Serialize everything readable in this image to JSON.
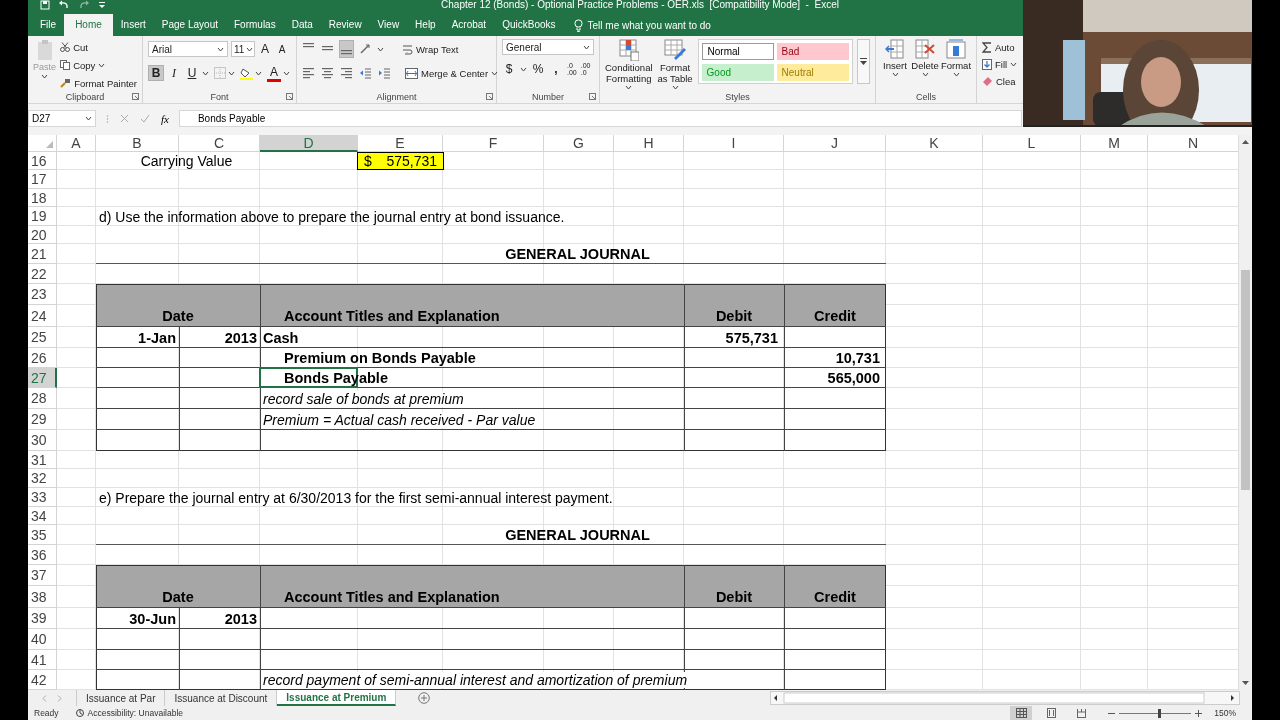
{
  "window": {
    "title": "Chapter 12 (Bonds) - Optional Practice Problems - OER.xls  [Compatibility Mode]  -  Excel"
  },
  "menu_tabs": [
    {
      "label": "File",
      "selected": false
    },
    {
      "label": "Home",
      "selected": true
    },
    {
      "label": "Insert",
      "selected": false
    },
    {
      "label": "Page Layout",
      "selected": false
    },
    {
      "label": "Formulas",
      "selected": false
    },
    {
      "label": "Data",
      "selected": false
    },
    {
      "label": "Review",
      "selected": false
    },
    {
      "label": "View",
      "selected": false
    },
    {
      "label": "Help",
      "selected": false
    },
    {
      "label": "Acrobat",
      "selected": false
    },
    {
      "label": "QuickBooks",
      "selected": false
    }
  ],
  "tell_me": {
    "placeholder": "Tell me what you want to do"
  },
  "ribbon": {
    "clipboard": {
      "name": "Clipboard",
      "paste": {
        "label": "Paste",
        "disabled": true
      },
      "cut": "Cut",
      "copy": "Copy",
      "format_painter": "Format Painter"
    },
    "font": {
      "name": "Font",
      "font_name": "Arial",
      "font_size": "11",
      "grow": "A",
      "shrink": "A",
      "font_color": "A",
      "buttons": [
        {
          "label": "B",
          "kind": "bold",
          "on": true
        },
        {
          "label": "I",
          "kind": "italic",
          "on": false
        },
        {
          "label": "U",
          "kind": "underline",
          "on": false
        }
      ]
    },
    "alignment": {
      "name": "Alignment",
      "wrap_text": "Wrap Text",
      "merge_center": "Merge & Center",
      "vertical_align": [
        {
          "selected": false
        },
        {
          "selected": false
        },
        {
          "selected": true
        }
      ]
    },
    "number": {
      "name": "Number",
      "format": "General",
      "currency": "$",
      "percent": "%",
      "comma": ",",
      "increase_decimal": [
        ".0",
        ".00"
      ],
      "decrease_decimal": [
        ".00",
        ".0"
      ]
    },
    "styles": {
      "name": "Styles",
      "conditional": "Conditional Formatting",
      "format_table": "Format as Table",
      "cell_styles": [
        {
          "label": "Normal",
          "color": "#ffffff"
        },
        {
          "label": "Bad",
          "color": "#ffc7ce"
        },
        {
          "label": "Good",
          "color": "#c6efce"
        },
        {
          "label": "Neutral",
          "color": "#ffeb9c"
        }
      ]
    },
    "cells": {
      "name": "Cells",
      "buttons": [
        "Insert",
        "Delete",
        "Format"
      ]
    },
    "editing": {
      "buttons": [
        "Auto",
        "Fill",
        "Clea"
      ]
    }
  },
  "formula_bar": {
    "name_box": "D27",
    "function_label": "fx",
    "value": "Bonds Payable"
  },
  "sheet": {
    "columns": [
      {
        "label": "A",
        "selected": false
      },
      {
        "label": "B",
        "selected": false
      },
      {
        "label": "C",
        "selected": false
      },
      {
        "label": "D",
        "selected": true
      },
      {
        "label": "E",
        "selected": false
      },
      {
        "label": "F",
        "selected": false
      },
      {
        "label": "G",
        "selected": false
      },
      {
        "label": "H",
        "selected": false
      },
      {
        "label": "I",
        "selected": false
      },
      {
        "label": "J",
        "selected": false
      },
      {
        "label": "K",
        "selected": false
      },
      {
        "label": "L",
        "selected": false
      },
      {
        "label": "M",
        "selected": false
      },
      {
        "label": "N",
        "selected": false
      }
    ],
    "rows": [
      {
        "number": "16",
        "selected": false,
        "kind": "plain",
        "label": "Carrying Value",
        "value": {
          "symbol": "$",
          "text": "575,731",
          "highlighted": true
        }
      },
      {
        "number": "17",
        "selected": false,
        "kind": "plain"
      },
      {
        "number": "18",
        "selected": false,
        "kind": "plain"
      },
      {
        "number": "19",
        "selected": false,
        "kind": "plain",
        "note": "d) Use the information above to prepare the journal entry at bond issuance."
      },
      {
        "number": "20",
        "selected": false,
        "kind": "plain"
      },
      {
        "number": "21",
        "selected": false,
        "kind": "title",
        "title": "GENERAL JOURNAL"
      },
      {
        "number": "22",
        "selected": false,
        "kind": "plain"
      },
      {
        "number": "23",
        "selected": false,
        "kind": "journal-header"
      },
      {
        "number": "24",
        "selected": false,
        "kind": "journal-header",
        "date": "Date",
        "account": "Account Titles and Explanation",
        "debit": "Debit",
        "credit": "Credit"
      },
      {
        "number": "25",
        "selected": false,
        "kind": "journal-line",
        "date": "1-Jan",
        "year": "2013",
        "account": "Cash",
        "debit": "575,731"
      },
      {
        "number": "26",
        "selected": false,
        "kind": "journal-line",
        "sub_account": "Premium on Bonds Payable",
        "credit": "10,731"
      },
      {
        "number": "27",
        "selected": true,
        "kind": "journal-line",
        "sub_account": "Bonds Payable",
        "credit": "565,000"
      },
      {
        "number": "28",
        "selected": false,
        "kind": "journal-line",
        "explanation": "record sale of bonds at premium"
      },
      {
        "number": "29",
        "selected": false,
        "kind": "journal-line",
        "explanation": "Premium = Actual cash received - Par value"
      },
      {
        "number": "30",
        "selected": false,
        "kind": "journal-line"
      },
      {
        "number": "31",
        "selected": false,
        "kind": "plain"
      },
      {
        "number": "32",
        "selected": false,
        "kind": "plain"
      },
      {
        "number": "33",
        "selected": false,
        "kind": "plain",
        "note": "e) Prepare the journal entry at 6/30/2013 for the first semi-annual interest payment."
      },
      {
        "number": "34",
        "selected": false,
        "kind": "plain"
      },
      {
        "number": "35",
        "selected": false,
        "kind": "title",
        "title": "GENERAL JOURNAL"
      },
      {
        "number": "36",
        "selected": false,
        "kind": "plain"
      },
      {
        "number": "37",
        "selected": false,
        "kind": "journal-header"
      },
      {
        "number": "38",
        "selected": false,
        "kind": "journal-header",
        "date": "Date",
        "account": "Account Titles and Explanation",
        "debit": "Debit",
        "credit": "Credit"
      },
      {
        "number": "39",
        "selected": false,
        "kind": "journal-line",
        "date": "30-Jun",
        "year": "2013"
      },
      {
        "number": "40",
        "selected": false,
        "kind": "journal-line"
      },
      {
        "number": "41",
        "selected": false,
        "kind": "journal-line"
      },
      {
        "number": "42",
        "selected": false,
        "kind": "journal-line",
        "explanation": "record payment of semi-annual interest and amortization of premium"
      }
    ]
  },
  "sheet_tabs": [
    {
      "label": "Issuance at Par",
      "selected": false
    },
    {
      "label": "Issuance at Discount",
      "selected": false
    },
    {
      "label": "Issuance at Premium",
      "selected": true
    }
  ],
  "status_bar": {
    "status": "Ready",
    "accessibility": "Accessibility: Unavailable",
    "views": [
      {
        "kind": "normal",
        "selected": true
      },
      {
        "kind": "page-layout",
        "selected": false
      },
      {
        "kind": "page-break",
        "selected": false
      }
    ],
    "zoom": {
      "level": 0.55,
      "reading": "150%"
    }
  }
}
